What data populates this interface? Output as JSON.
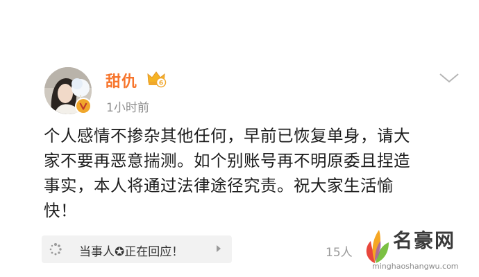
{
  "post": {
    "author": {
      "name": "甜仇",
      "verified": true,
      "member_badge_level": "6"
    },
    "time": "1小时前",
    "text": "个人感情不掺杂其他任何，早前已恢复单身，请大\n家不要再恶意揣测。如个别账号再不明原委且捏造\n事实，本人将通过法律途径究责。祝大家生活愉\n快！",
    "topic_chip": {
      "label": "当事人✪正在回应！"
    },
    "reply_count": "15人"
  },
  "watermark": {
    "brand": "名豪网",
    "url": "minghaoshangwu.com"
  },
  "colors": {
    "username": "#f7752c",
    "badge_gold": "#f0a72c",
    "chip_bg": "#f2f2f2"
  }
}
